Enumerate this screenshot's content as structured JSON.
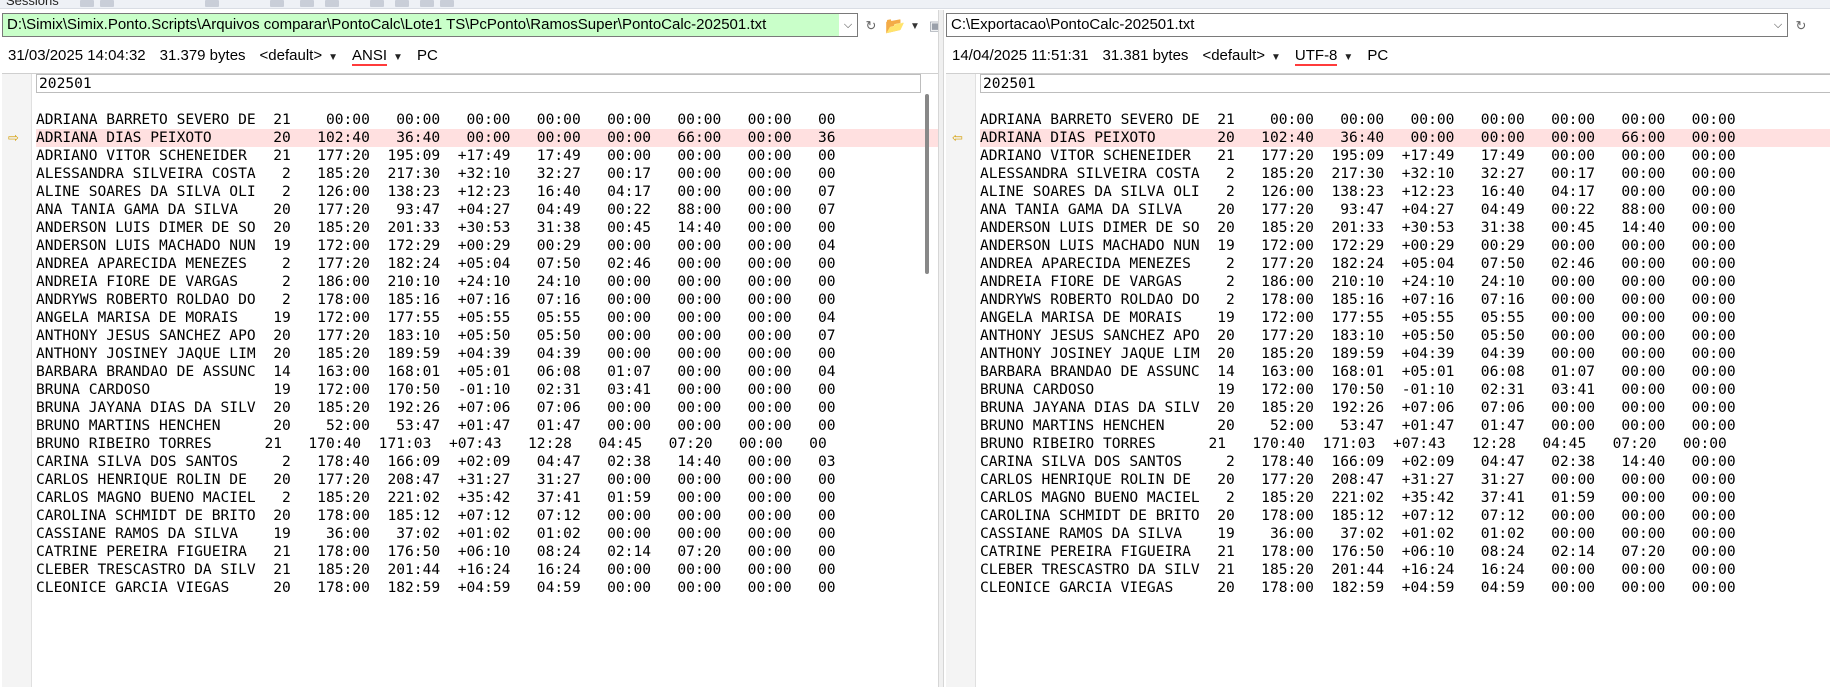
{
  "toolbar": {
    "sessions_label": "Sessions"
  },
  "left": {
    "path": "D:\\Simix\\Simix.Ponto.Scripts\\Arquivos comparar\\PontoCalc\\Lote1 TS\\PcPonto\\RamosSuper\\PontoCalc-202501.txt",
    "timestamp": "31/03/2025 14:04:32",
    "size": "31.379 bytes",
    "profile": "<default>",
    "encoding": "ANSI",
    "line_ending": "PC",
    "header_line": "202501",
    "lines": [
      "",
      "ADRIANA BARRETO SEVERO DE  21    00:00   00:00   00:00   00:00   00:00   00:00   00:00   00",
      "ADRIANA DIAS PEIXOTO       20   102:40   36:40   00:00   00:00   00:00   66:00   00:00   36",
      "ADRIANO VITOR SCHENEIDER   21   177:20  195:09  +17:49   17:49   00:00   00:00   00:00   00",
      "ALESSANDRA SILVEIRA COSTA   2   185:20  217:30  +32:10   32:27   00:17   00:00   00:00   00",
      "ALINE SOARES DA SILVA OLI   2   126:00  138:23  +12:23   16:40   04:17   00:00   00:00   07",
      "ANA TANIA GAMA DA SILVA    20   177:20   93:47  +04:27   04:49   00:22   88:00   00:00   07",
      "ANDERSON LUIS DIMER DE SO  20   185:20  201:33  +30:53   31:38   00:45   14:40   00:00   00",
      "ANDERSON LUIS MACHADO NUN  19   172:00  172:29  +00:29   00:29   00:00   00:00   00:00   04",
      "ANDREA APARECIDA MENEZES    2   177:20  182:24  +05:04   07:50   02:46   00:00   00:00   00",
      "ANDREIA FIORE DE VARGAS     2   186:00  210:10  +24:10   24:10   00:00   00:00   00:00   00",
      "ANDRYWS ROBERTO ROLDAO DO   2   178:00  185:16  +07:16   07:16   00:00   00:00   00:00   00",
      "ANGELA MARISA DE MORAIS    19   172:00  177:55  +05:55   05:55   00:00   00:00   00:00   04",
      "ANTHONY JESUS SANCHEZ APO  20   177:20  183:10  +05:50   05:50   00:00   00:00   00:00   07",
      "ANTHONY JOSINEY JAQUE LIM  20   185:20  189:59  +04:39   04:39   00:00   00:00   00:00   00",
      "BARBARA BRANDAO DE ASSUNC  14   163:00  168:01  +05:01   06:08   01:07   00:00   00:00   04",
      "BRUNA CARDOSO              19   172:00  170:50  -01:10   02:31   03:41   00:00   00:00   00",
      "BRUNA JAYANA DIAS DA SILV  20   185:20  192:26  +07:06   07:06   00:00   00:00   00:00   00",
      "BRUNO MARTINS HENCHEN      20    52:00   53:47  +01:47   01:47   00:00   00:00   00:00   00",
      "BRUNO RIBEIRO TORRES      21   170:40  171:03  +07:43   12:28   04:45   07:20   00:00   00",
      "CARINA SILVA DOS SANTOS     2   178:40  166:09  +02:09   04:47   02:38   14:40   00:00   03",
      "CARLOS HENRIQUE ROLIN DE   20   177:20  208:47  +31:27   31:27   00:00   00:00   00:00   00",
      "CARLOS MAGNO BUENO MACIEL   2   185:20  221:02  +35:42   37:41   01:59   00:00   00:00   00",
      "CAROLINA SCHMIDT DE BRITO  20   178:00  185:12  +07:12   07:12   00:00   00:00   00:00   00",
      "CASSIANE RAMOS DA SILVA    19    36:00   37:02  +01:02   01:02   00:00   00:00   00:00   00",
      "CATRINE PEREIRA FIGUEIRA   21   178:00  176:50  +06:10   08:24   02:14   07:20   00:00   00",
      "CLEBER TRESCASTRO DA SILV  21   185:20  201:44  +16:24   16:24   00:00   00:00   00:00   00",
      "CLEONICE GARCIA VIEGAS     20   178:00  182:59  +04:59   04:59   00:00   00:00   00:00   00"
    ]
  },
  "right": {
    "path": "C:\\Exportacao\\PontoCalc-202501.txt",
    "timestamp": "14/04/2025 11:51:31",
    "size": "31.381 bytes",
    "profile": "<default>",
    "encoding": "UTF-8",
    "line_ending": "PC",
    "header_line": "202501",
    "lines": [
      "",
      "ADRIANA BARRETO SEVERO DE  21    00:00   00:00   00:00   00:00   00:00   00:00   00:00",
      "ADRIANA DIAS PEIXOTO       20   102:40   36:40   00:00   00:00   00:00   66:00   00:00",
      "ADRIANO VITOR SCHENEIDER   21   177:20  195:09  +17:49   17:49   00:00   00:00   00:00",
      "ALESSANDRA SILVEIRA COSTA   2   185:20  217:30  +32:10   32:27   00:17   00:00   00:00",
      "ALINE SOARES DA SILVA OLI   2   126:00  138:23  +12:23   16:40   04:17   00:00   00:00",
      "ANA TANIA GAMA DA SILVA    20   177:20   93:47  +04:27   04:49   00:22   88:00   00:00",
      "ANDERSON LUIS DIMER DE SO  20   185:20  201:33  +30:53   31:38   00:45   14:40   00:00",
      "ANDERSON LUIS MACHADO NUN  19   172:00  172:29  +00:29   00:29   00:00   00:00   00:00",
      "ANDREA APARECIDA MENEZES    2   177:20  182:24  +05:04   07:50   02:46   00:00   00:00",
      "ANDREIA FIORE DE VARGAS     2   186:00  210:10  +24:10   24:10   00:00   00:00   00:00",
      "ANDRYWS ROBERTO ROLDAO DO   2   178:00  185:16  +07:16   07:16   00:00   00:00   00:00",
      "ANGELA MARISA DE MORAIS    19   172:00  177:55  +05:55   05:55   00:00   00:00   00:00",
      "ANTHONY JESUS SANCHEZ APO  20   177:20  183:10  +05:50   05:50   00:00   00:00   00:00",
      "ANTHONY JOSINEY JAQUE LIM  20   185:20  189:59  +04:39   04:39   00:00   00:00   00:00",
      "BARBARA BRANDAO DE ASSUNC  14   163:00  168:01  +05:01   06:08   01:07   00:00   00:00",
      "BRUNA CARDOSO              19   172:00  170:50  -01:10   02:31   03:41   00:00   00:00",
      "BRUNA JAYANA DIAS DA SILV  20   185:20  192:26  +07:06   07:06   00:00   00:00   00:00",
      "BRUNO MARTINS HENCHEN      20    52:00   53:47  +01:47   01:47   00:00   00:00   00:00",
      "BRUNO RIBEIRO TORRES      21   170:40  171:03  +07:43   12:28   04:45   07:20   00:00",
      "CARINA SILVA DOS SANTOS     2   178:40  166:09  +02:09   04:47   02:38   14:40   00:00",
      "CARLOS HENRIQUE ROLIN DE   20   177:20  208:47  +31:27   31:27   00:00   00:00   00:00",
      "CARLOS MAGNO BUENO MACIEL   2   185:20  221:02  +35:42   37:41   01:59   00:00   00:00",
      "CAROLINA SCHMIDT DE BRITO  20   178:00  185:12  +07:12   07:12   00:00   00:00   00:00",
      "CASSIANE RAMOS DA SILVA    19    36:00   37:02  +01:02   01:02   00:00   00:00   00:00",
      "CATRINE PEREIRA FIGUEIRA   21   178:00  176:50  +06:10   08:24   02:14   07:20   00:00",
      "CLEBER TRESCASTRO DA SILV  21   185:20  201:44  +16:24   16:24   00:00   00:00   00:00",
      "CLEONICE GARCIA VIEGAS     20   178:00  182:59  +04:59   04:59   00:00   00:00   00:00"
    ]
  },
  "diff_line_indexes": [
    2
  ],
  "icons": {
    "diff_left": "arrow-right-icon",
    "diff_right": "arrow-left-icon",
    "folder": "folder-open-icon",
    "save": "save-icon",
    "refresh": "refresh-icon"
  },
  "colors": {
    "left_path_bg": "#c9ffc9",
    "diff_row_bg": "#ffe0e0",
    "encoding_underline": "#ff3b3b",
    "diff_arrow": "#d4a00c"
  }
}
